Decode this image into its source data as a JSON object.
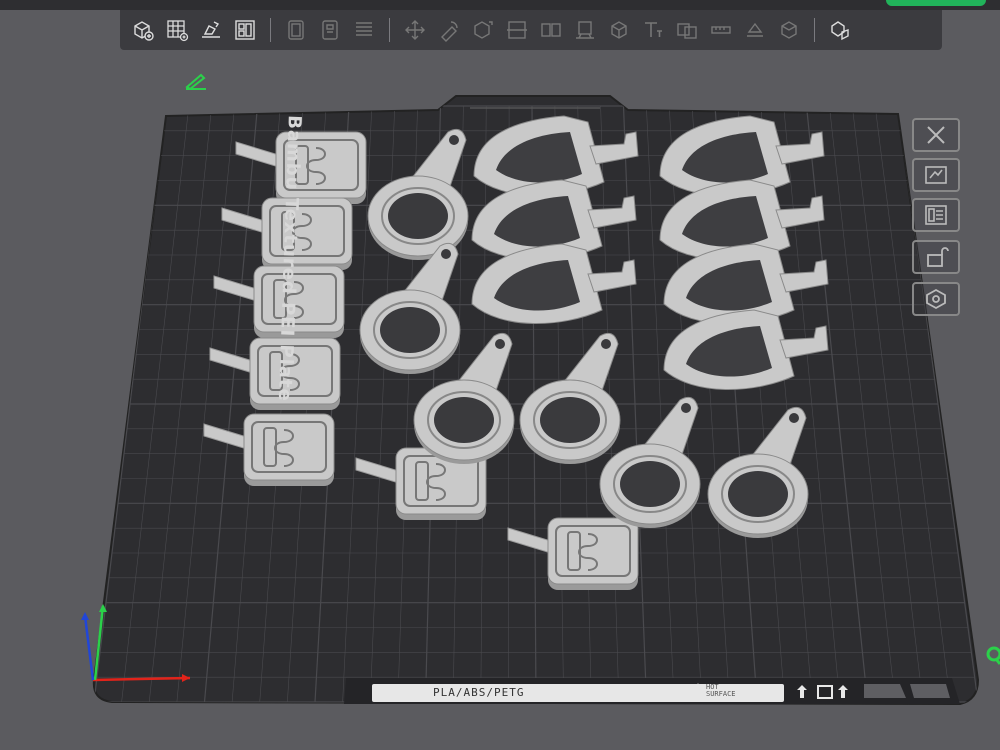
{
  "app": {
    "accent": "#21b35a"
  },
  "toolbar": {
    "groups": [
      [
        "add-object-icon",
        "grid-icon",
        "auto-orient-icon",
        "arrange-icon"
      ],
      [
        "plate-1-icon",
        "plate-2-icon",
        "layers-icon"
      ],
      [
        "move-icon",
        "rotate-icon",
        "scale-icon",
        "cut-icon",
        "split-icon",
        "lay-on-face-icon",
        "support-paint-icon",
        "text-icon",
        "mesh-boolean-icon",
        "measure-icon",
        "seam-icon",
        "color-paint-icon"
      ],
      [
        "assembly-icon"
      ]
    ]
  },
  "plate": {
    "name": "Bambu Textured PEI Plate",
    "filament_label": "PLA/ABS/PETG",
    "warning": "HOT\nSURFACE"
  },
  "colors": {
    "plate": "#2d2d30",
    "grid": "#4a4a4e",
    "parts": "#c9c9c9",
    "parts_shadow": "#9a9a9a",
    "x_axis": "#e2231a",
    "y_axis": "#2bd14a",
    "z_axis": "#2146d8"
  }
}
